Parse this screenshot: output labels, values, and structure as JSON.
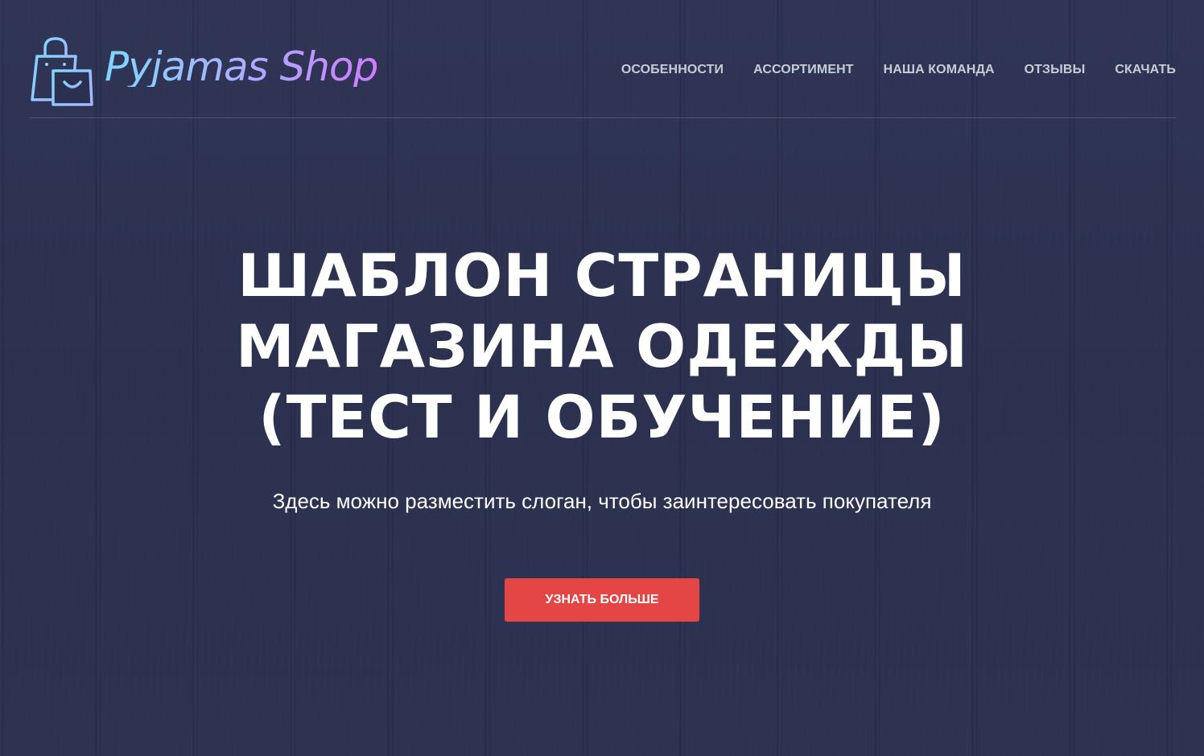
{
  "brand": {
    "name": "Pyjamas Shop",
    "icon": "shopping-bag-icon",
    "gradient_colors": [
      "#7fd6ff",
      "#a7b4ff",
      "#d07cff"
    ]
  },
  "nav": {
    "items": [
      {
        "label": "ОСОБЕННОСТИ"
      },
      {
        "label": "АССОРТИМЕНТ"
      },
      {
        "label": "НАША КОМАНДА"
      },
      {
        "label": "ОТЗЫВЫ"
      },
      {
        "label": "СКАЧАТЬ"
      }
    ]
  },
  "hero": {
    "title_lines": [
      "ШАБЛОН СТРАНИЦЫ",
      "МАГАЗИНА ОДЕЖДЫ",
      "(ТЕСТ И ОБУЧЕНИЕ)"
    ],
    "tagline": "Здесь можно разместить слоган, чтобы заинтересовать покупателя",
    "cta_label": "УЗНАТЬ БОЛЬШЕ"
  },
  "colors": {
    "background": "#2b3050",
    "cta": "#e44545",
    "nav_text": "#c9cbd6"
  }
}
